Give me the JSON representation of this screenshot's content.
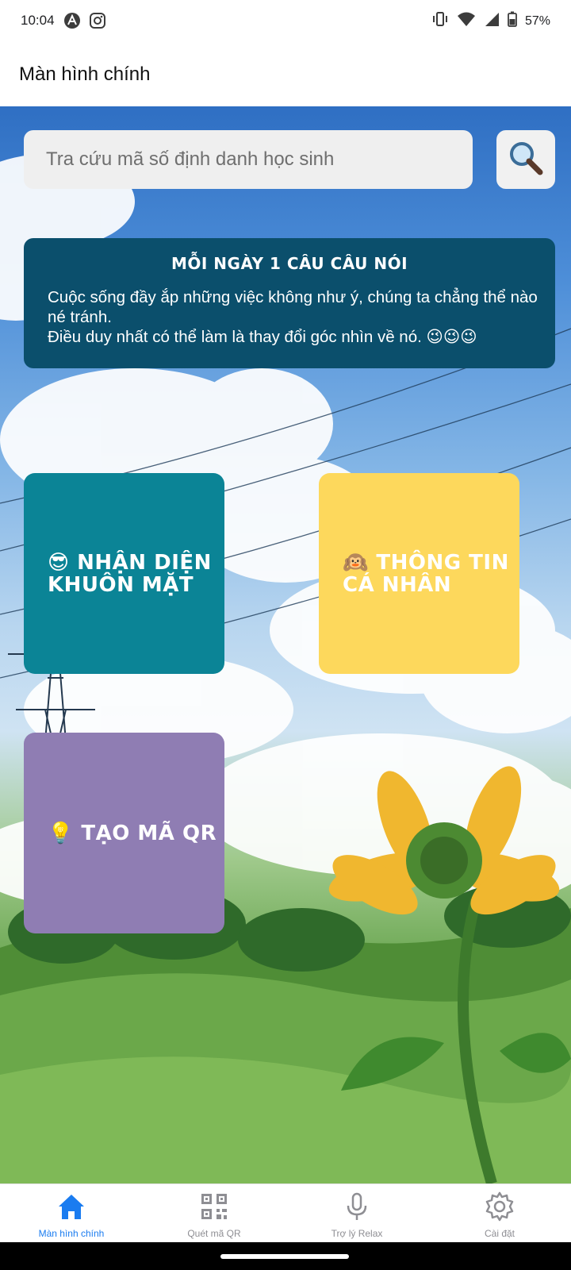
{
  "status_bar": {
    "time": "10:04",
    "battery_percent": "57%",
    "icons": [
      "notification-a-icon",
      "instagram-icon",
      "vibrate-icon",
      "wifi-icon",
      "signal-icon",
      "battery-icon"
    ]
  },
  "app_bar": {
    "title": "Màn hình chính"
  },
  "search": {
    "placeholder": "Tra cứu mã số định danh học sinh",
    "button_icon": "search-icon"
  },
  "quote": {
    "title": "MỖI NGÀY 1 CÂU CÂU NÓI",
    "line1": "Cuộc sống đầy ắp những việc không như ý, chúng ta chẳng thể nào né tránh.",
    "line2": "Điều duy nhất có thể làm là thay đổi góc nhìn về nó. 😉😉😉"
  },
  "tiles": [
    {
      "label": "😎 NHẬN DIỆN\nKHUÔN MẶT",
      "color": "#0b8496"
    },
    {
      "label": "🙉 THÔNG TIN\nCÁ NHÂN",
      "color": "#fdd85c"
    },
    {
      "label": "💡 TẠO MÃ QR",
      "color": "#8f7db3"
    }
  ],
  "bottom_nav": {
    "items": [
      {
        "label": "Màn hình chính",
        "icon": "home-icon",
        "active": true
      },
      {
        "label": "Quét mã QR",
        "icon": "qr-code-icon",
        "active": false
      },
      {
        "label": "Trợ lý Relax",
        "icon": "microphone-icon",
        "active": false
      },
      {
        "label": "Cài đặt",
        "icon": "gear-icon",
        "active": false
      }
    ],
    "active_color": "#1a7cf0",
    "inactive_color": "#8e8e93"
  }
}
